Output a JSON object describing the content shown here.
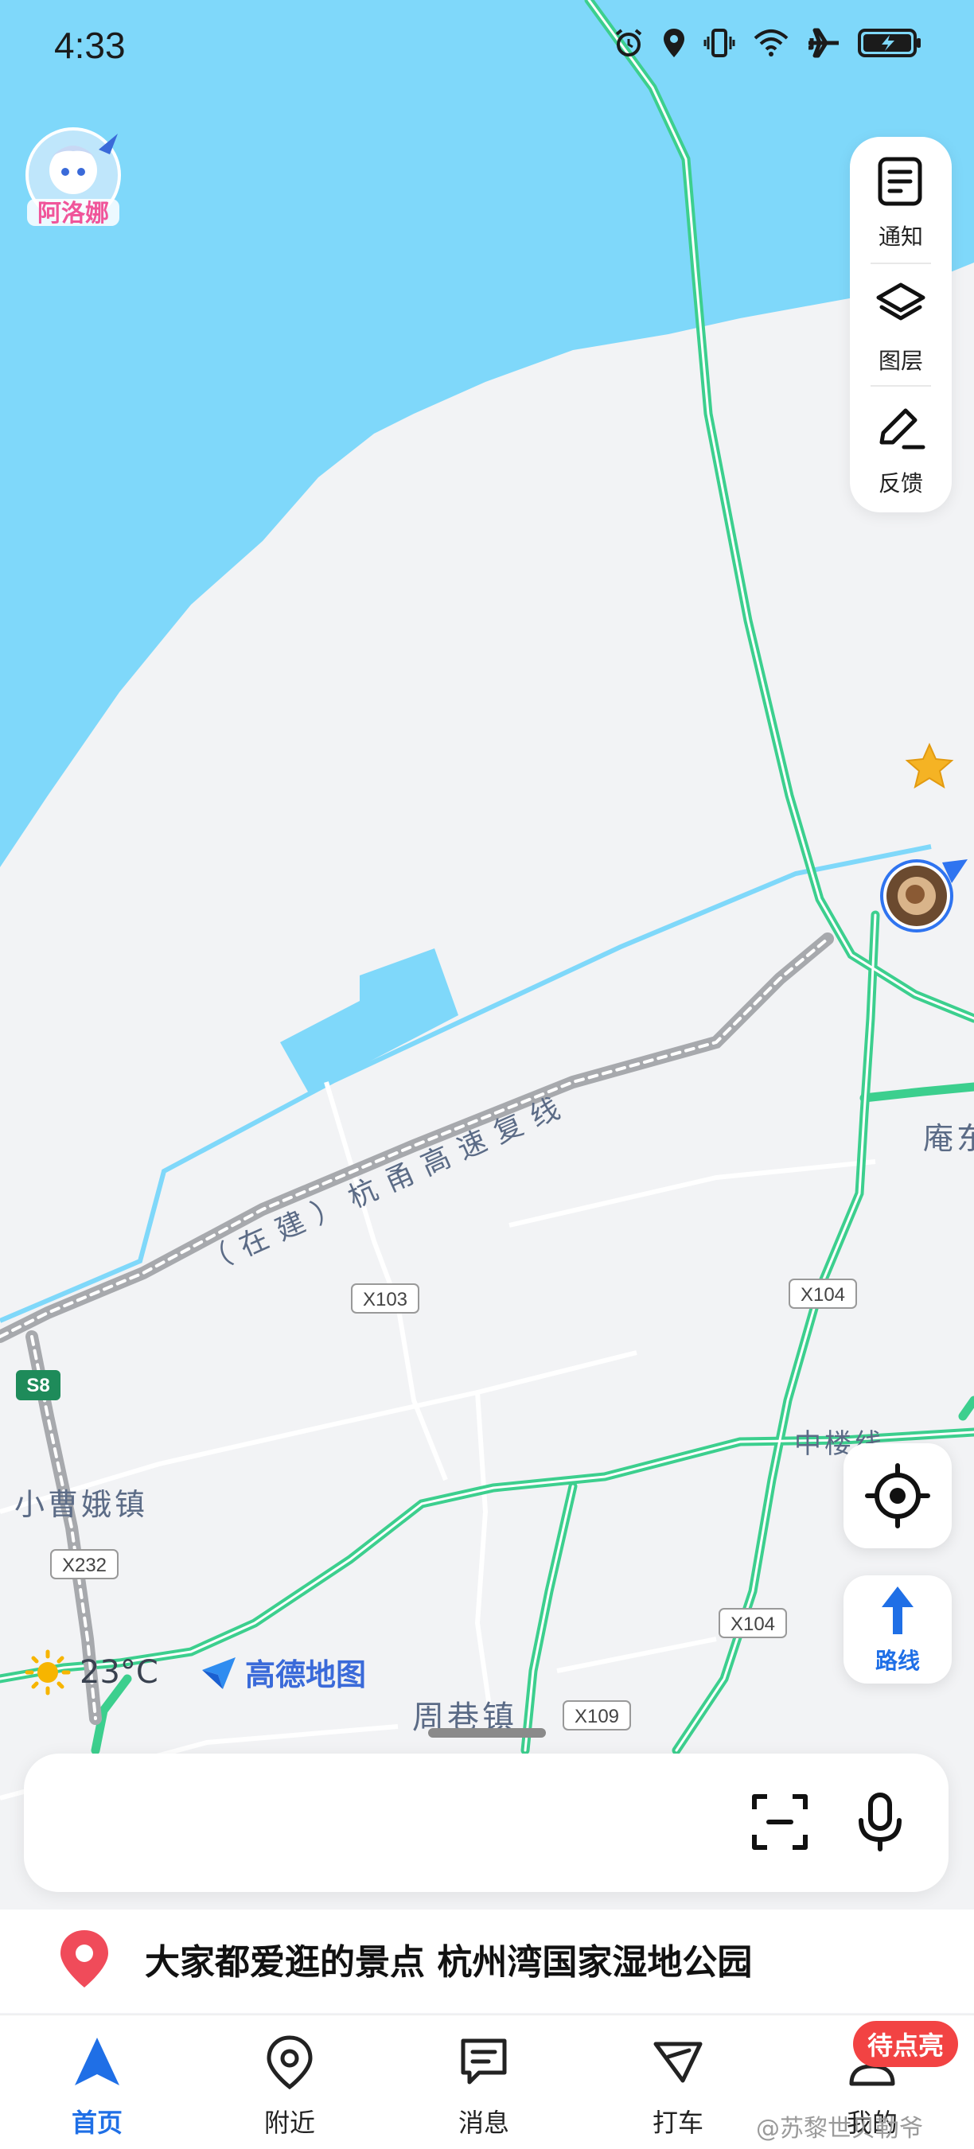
{
  "status_bar": {
    "time": "4:33",
    "icons": [
      "alarm-icon",
      "location-icon",
      "vibrate-icon",
      "wifi-icon",
      "airplane-icon",
      "battery-charging-icon"
    ]
  },
  "badge_logo": "阿洛娜",
  "side_panel": {
    "notify": "通知",
    "layers": "图层",
    "feedback": "反馈"
  },
  "map": {
    "labels": {
      "highway": "（在建）杭甬高速复线",
      "x103": "X103",
      "x104_a": "X104",
      "x104_b": "X104",
      "x109": "X109",
      "x232": "X232",
      "s8": "S8",
      "town_xiaocao": "小曹娥镇",
      "town_zhouxiang": "周巷镇",
      "zhonglou": "中楼线",
      "andong": "庵东"
    },
    "colors": {
      "water": "#7fd8fa",
      "land": "#f2f3f5",
      "road_green": "#3ccf8e",
      "expressway": "#a7a9ad"
    }
  },
  "weather": {
    "icon": "sun-icon",
    "temp": "23°C"
  },
  "brand": {
    "name": "高德地图"
  },
  "route_button": {
    "label": "路线"
  },
  "search": {
    "placeholder": ""
  },
  "suggestion": {
    "text": "大家都爱逛的景点 杭州湾国家湿地公园"
  },
  "tabs": [
    {
      "label": "首页",
      "active": true
    },
    {
      "label": "附近",
      "active": false
    },
    {
      "label": "消息",
      "active": false
    },
    {
      "label": "打车",
      "active": false
    },
    {
      "label": "我的",
      "active": false
    }
  ],
  "tab_badge": "待点亮",
  "watermark": "@苏黎世贝勒爷"
}
